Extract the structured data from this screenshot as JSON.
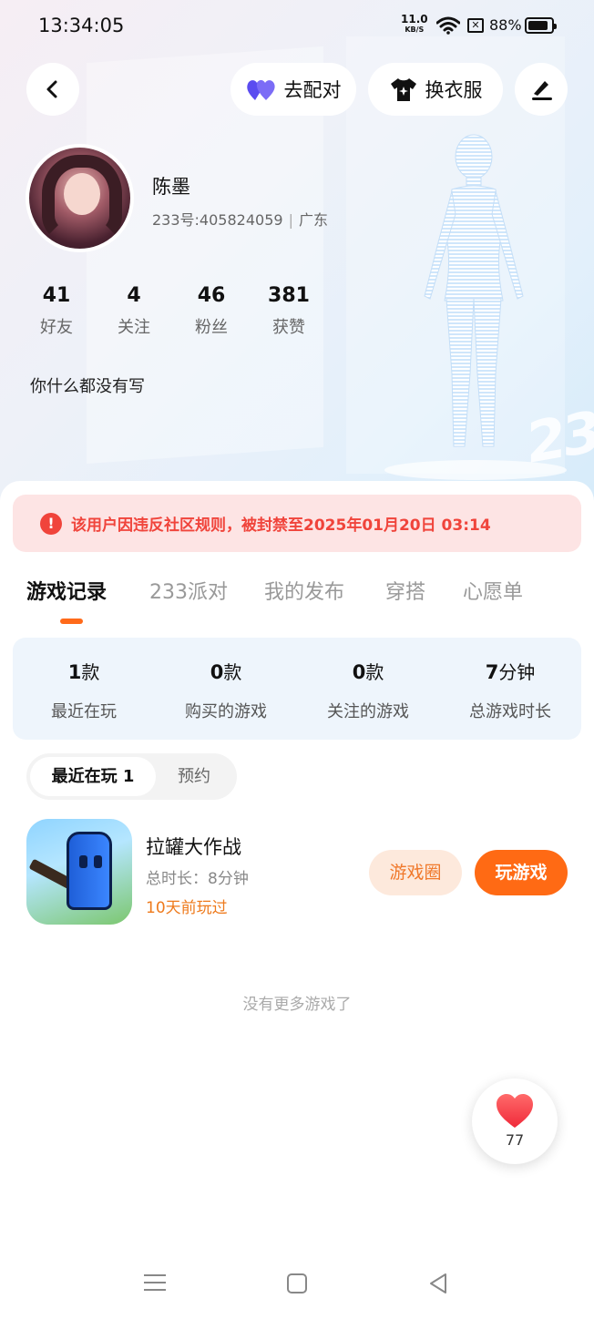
{
  "status_bar": {
    "time": "13:34:05",
    "net_speed": "11.0",
    "net_unit": "KB/S",
    "battery": "88%"
  },
  "header": {
    "match_label": "去配对",
    "outfit_label": "换衣服"
  },
  "profile": {
    "name": "陈墨",
    "uid": "233号:405824059",
    "region": "广东",
    "bio": "你什么都没有写",
    "stats": [
      {
        "value": "41",
        "label": "好友"
      },
      {
        "value": "4",
        "label": "关注"
      },
      {
        "value": "46",
        "label": "粉丝"
      },
      {
        "value": "381",
        "label": "获赞"
      }
    ]
  },
  "ban_notice": "该用户因违反社区规则，被封禁至2025年01月20日 03:14",
  "tabs": [
    "游戏记录",
    "233派对",
    "我的发布",
    "穿搭",
    "心愿单"
  ],
  "summary": [
    {
      "value": "1",
      "unit": "款",
      "label": "最近在玩"
    },
    {
      "value": "0",
      "unit": "款",
      "label": "购买的游戏"
    },
    {
      "value": "0",
      "unit": "款",
      "label": "关注的游戏"
    },
    {
      "value": "7",
      "unit": "分钟",
      "label": "总游戏时长"
    }
  ],
  "segment": {
    "active": "最近在玩 1",
    "inactive": "预约"
  },
  "game": {
    "title": "拉罐大作战",
    "duration": "总时长：8分钟",
    "last_played": "10天前玩过",
    "circle_label": "游戏圈",
    "play_label": "玩游戏"
  },
  "no_more": "没有更多游戏了",
  "like_count": "77",
  "colors": {
    "accent": "#ff6a14",
    "ban_text": "#f0443b",
    "ban_bg": "#fde4e4",
    "summary_bg": "#eef5fc"
  }
}
